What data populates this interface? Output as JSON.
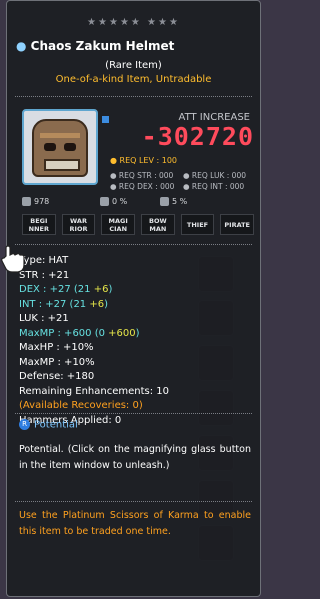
{
  "tooltip": {
    "stars": "★★★★★ ★★★",
    "item_name": "Chaos Zakum Helmet",
    "rarity": "(Rare Item)",
    "unique_text": "One-of-a-kind Item, Untradable",
    "att_label": "ATT INCREASE",
    "att_value": "-302720",
    "req_lev": "● REQ LEV : 100",
    "req": {
      "str": "● REQ STR : 000",
      "luk": "● REQ LUK : 000",
      "dex": "● REQ DEX : 000",
      "int": "● REQ INT : 000"
    },
    "meters": {
      "a": "978",
      "b": "0 %",
      "c": "5 %"
    },
    "jobs": [
      "BEGI NNER",
      "WAR RIOR",
      "MAGI CIAN",
      "BOW MAN",
      "THIEF",
      "PIRATE"
    ],
    "stats": {
      "type": "Type: HAT",
      "str": "STR : +21",
      "dex_label": "DEX : +27 (21 ",
      "dex_bonus": "+6",
      "dex_close": ")",
      "int_label": "INT : +27 (21 ",
      "int_bonus": "+6",
      "int_close": ")",
      "luk": "LUK : +21",
      "maxmp_label": "MaxMP : +600 (0 ",
      "maxmp_bonus": "+600",
      "maxmp_close": ")",
      "maxhp_pct": "MaxHP : +10%",
      "maxmp_pct": "MaxMP : +10%",
      "defense": "Defense: +180",
      "enhancements": "Remaining Enhancements: 10",
      "recoveries": "(Available Recoveries: 0)",
      "hammers": "Hammers Applied: 0"
    },
    "potential_header": "Potential",
    "potential_icon": "R",
    "potential_text": "Potential. (Click on the magnifying glass button in the item window to unleash.)",
    "karma_text": "Use the Platinum Scissors of Karma to enable this item to be traded one time."
  },
  "icons": [
    "helmet-item-icon",
    "hand-cursor-icon",
    "potential-rank-icon"
  ],
  "colors": {
    "att_decrease": "#ff4b5c",
    "unique": "#ffbd2e",
    "stat_bonus": "#e6e64a",
    "stat_highlight": "#66e0e0",
    "karma": "#ffa11f",
    "potential": "#7ec7ff"
  }
}
